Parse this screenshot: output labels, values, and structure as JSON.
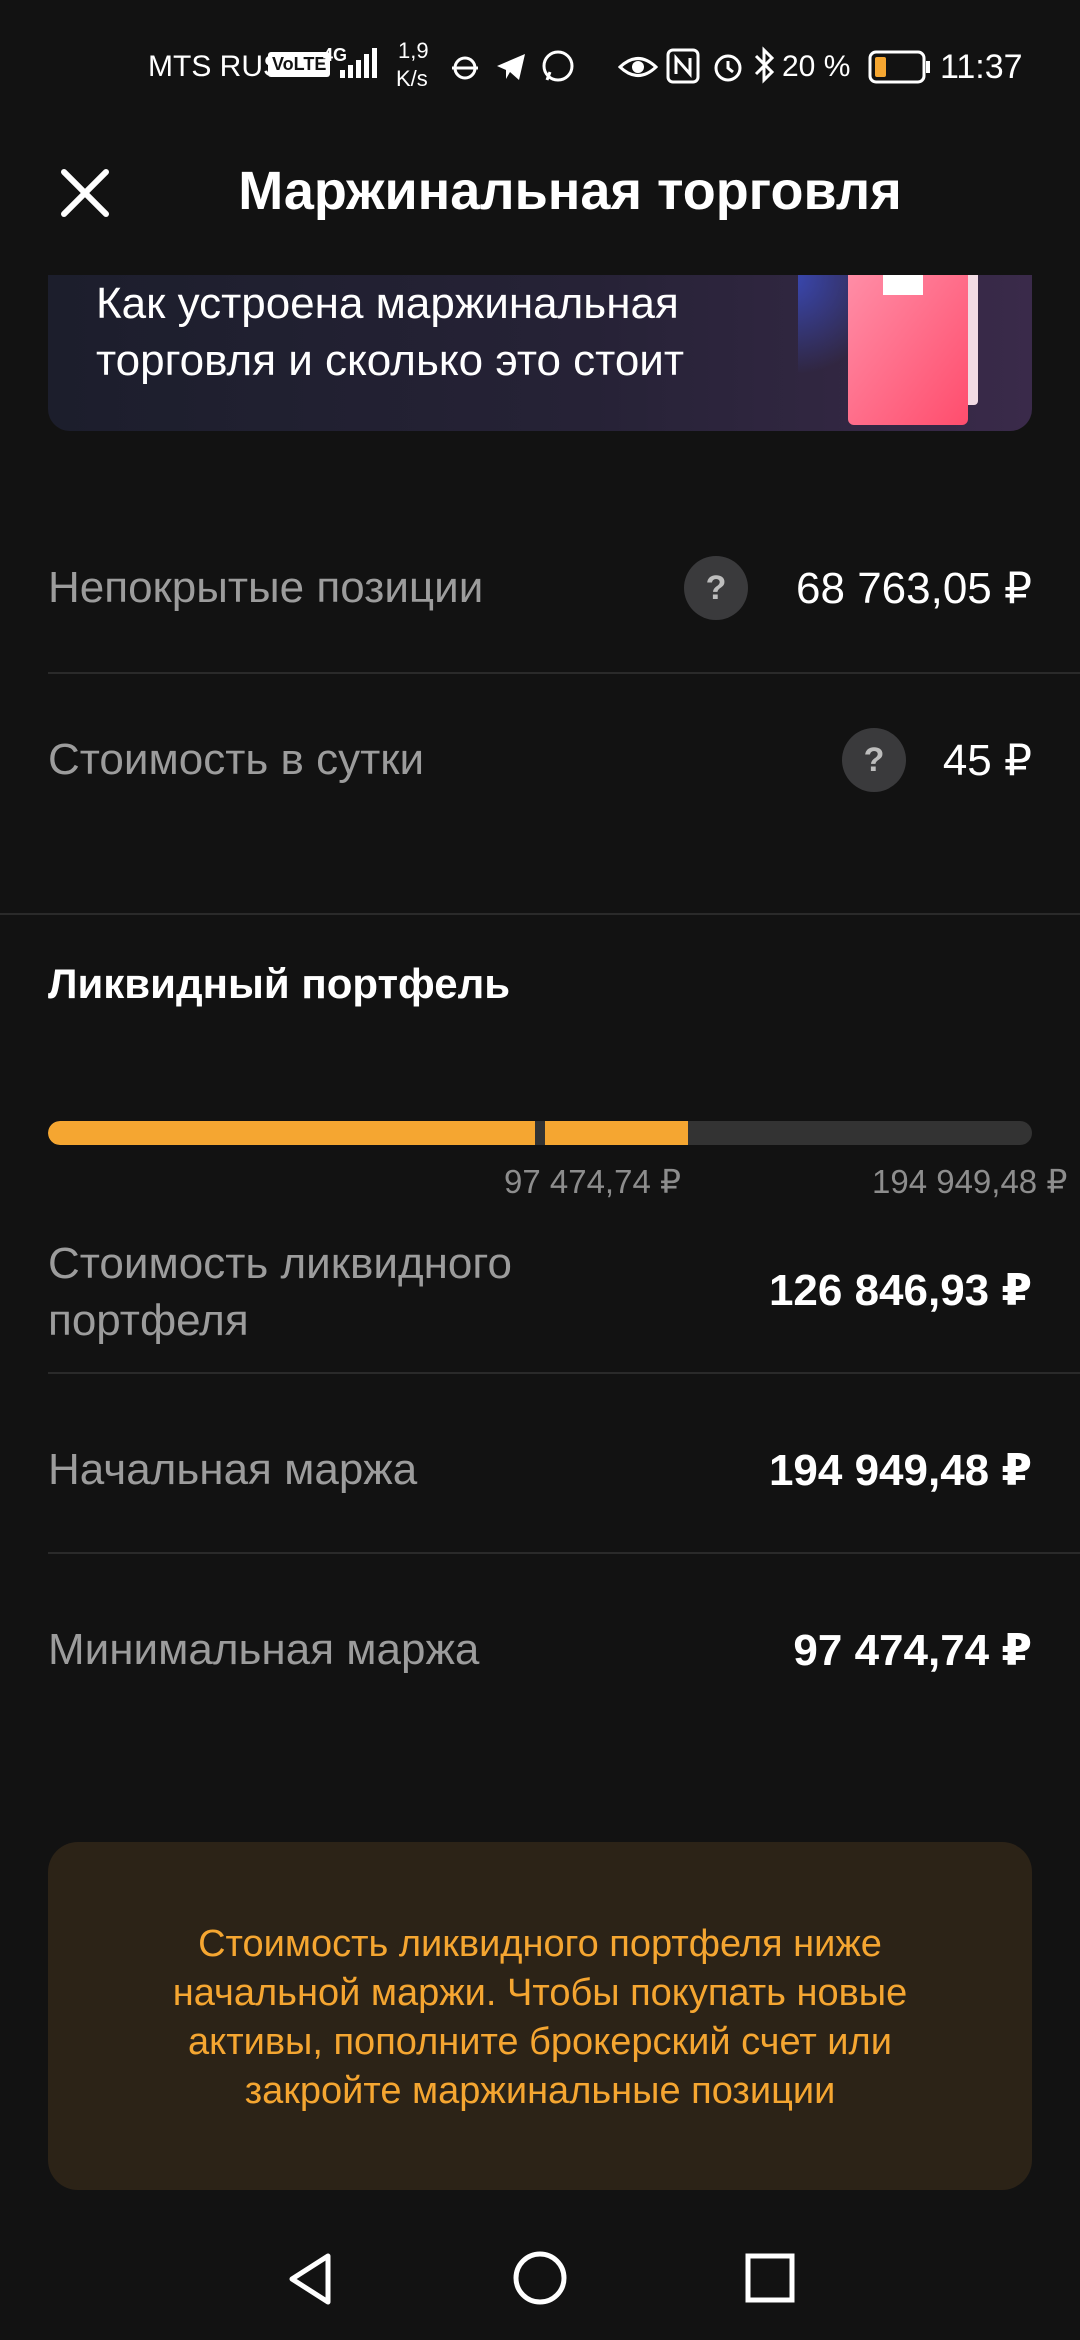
{
  "status_bar": {
    "carrier": "MTS RUS",
    "volte": "VoLTE",
    "network": "4G",
    "speed_value": "1,9",
    "speed_unit": "K/s",
    "battery": "20 %",
    "time": "11:37"
  },
  "header": {
    "title": "Маржинальная торговля"
  },
  "banner": {
    "text": "Как устроена маржинальная торговля и сколько это стоит"
  },
  "summary": {
    "uncovered_label": "Непокрытые позиции",
    "uncovered_value": "68 763,05 ₽",
    "daily_cost_label": "Стоимость в сутки",
    "daily_cost_value": "45 ₽",
    "help_symbol": "?"
  },
  "liquid": {
    "title": "Ликвидный портфель",
    "progress": {
      "value": 126846.93,
      "min_margin": 97474.74,
      "initial_margin": 194949.48,
      "min_label": "97 474,74 ₽",
      "max_label": "194 949,48 ₽"
    },
    "rows": [
      {
        "label": "Стоимость ликвидного портфеля",
        "value": "126 846,93 ₽"
      },
      {
        "label": "Начальная маржа",
        "value": "194 949,48 ₽"
      },
      {
        "label": "Минимальная маржа",
        "value": "97 474,74 ₽"
      }
    ]
  },
  "warning": {
    "text": "Стоимость ликвидного портфеля ниже начальной маржи. Чтобы покупать новые активы, пополните брокерский счет или закройте маржинальные позиции"
  },
  "colors": {
    "accent": "#f5a631",
    "background": "#121212",
    "warning_bg": "#2c2317",
    "muted_text": "#9c9c9c"
  },
  "icons": {
    "close": "close-icon",
    "help": "question-icon",
    "nav_back": "back-triangle-icon",
    "nav_home": "home-circle-icon",
    "nav_recent": "recent-square-icon"
  }
}
